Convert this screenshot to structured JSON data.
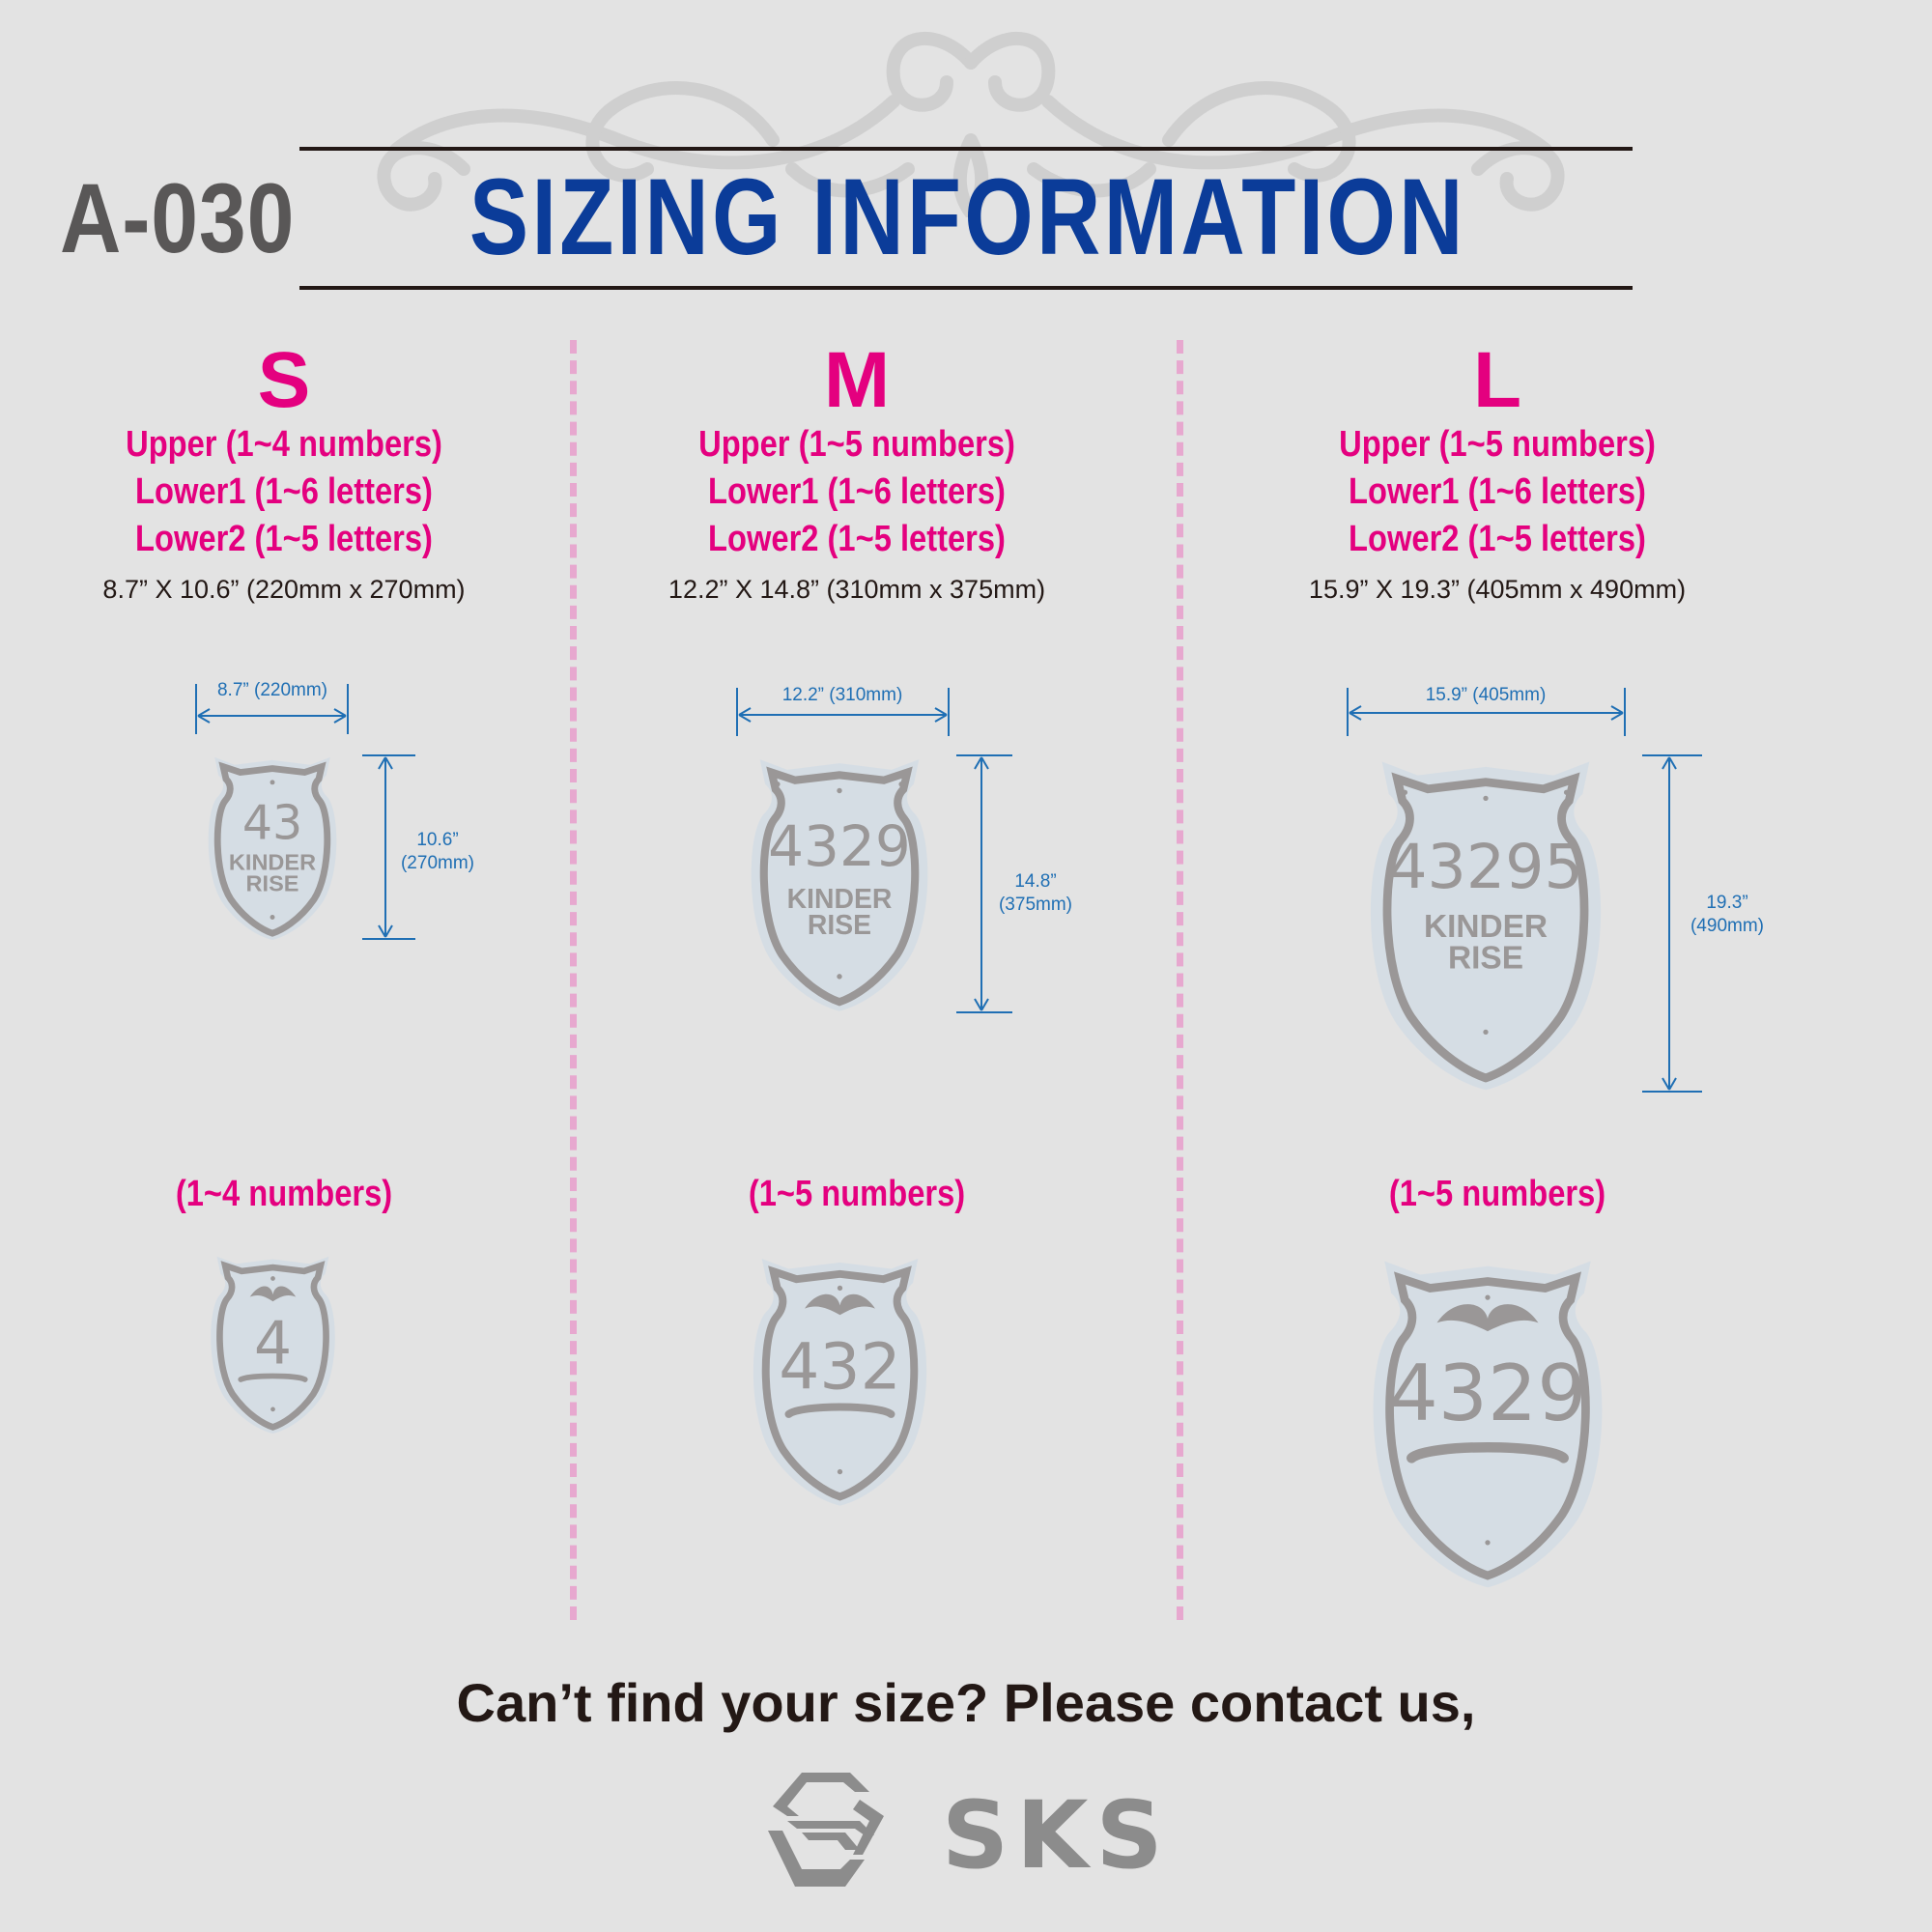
{
  "header": {
    "model_code": "A-030",
    "title": "SIZING INFORMATION"
  },
  "sizes": [
    {
      "letter": "S",
      "rules": [
        "Upper  (1~4 numbers)",
        "Lower1 (1~6 letters)",
        "Lower2 (1~5 letters)"
      ],
      "dimensions": "8.7” X 10.6”  (220mm x 270mm)",
      "width_label": "8.7” (220mm)",
      "height_label": [
        "10.6”",
        "(270mm)"
      ],
      "sample_number": "43",
      "sample_text": [
        "KINDER",
        "RISE"
      ],
      "numbers_only_label": "(1~4 numbers)",
      "numbers_only_sample": "4"
    },
    {
      "letter": "M",
      "rules": [
        "Upper  (1~5 numbers)",
        "Lower1 (1~6 letters)",
        "Lower2 (1~5 letters)"
      ],
      "dimensions": "12.2” X 14.8”  (310mm x 375mm)",
      "width_label": "12.2” (310mm)",
      "height_label": [
        "14.8”",
        "(375mm)"
      ],
      "sample_number": "4329",
      "sample_text": [
        "KINDER",
        "RISE"
      ],
      "numbers_only_label": "(1~5 numbers)",
      "numbers_only_sample": "432"
    },
    {
      "letter": "L",
      "rules": [
        "Upper  (1~5 numbers)",
        "Lower1 (1~6 letters)",
        "Lower2 (1~5 letters)"
      ],
      "dimensions": "15.9” X 19.3”  (405mm x 490mm)",
      "width_label": "15.9” (405mm)",
      "height_label": [
        "19.3”",
        "(490mm)"
      ],
      "sample_number": "43295",
      "sample_text": [
        "KINDER",
        "RISE"
      ],
      "numbers_only_label": "(1~5 numbers)",
      "numbers_only_sample": "4329"
    }
  ],
  "footer": {
    "contact_text": "Can’t find your size? Please contact us,",
    "brand": "SKS"
  },
  "colors": {
    "background": "#e3e3e3",
    "title_blue": "#0b3c99",
    "accent_magenta": "#e4007f",
    "dimension_blue": "#1f6fb4",
    "plaque_gray": "#9a9797",
    "plaque_fill": "#d5dde4"
  }
}
